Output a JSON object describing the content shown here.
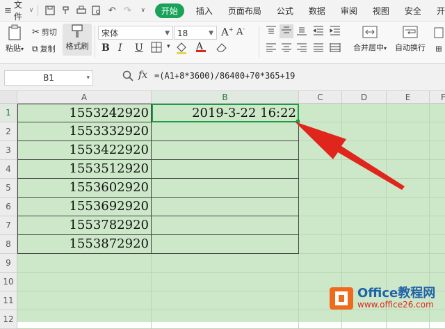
{
  "menu": {
    "file_label": "文件",
    "tabs": [
      "开始",
      "插入",
      "页面布局",
      "公式",
      "数据",
      "审阅",
      "视图",
      "安全",
      "开"
    ]
  },
  "ribbon": {
    "paste_label": "粘贴",
    "cut_label": "剪切",
    "copy_label": "复制",
    "format_brush_label": "格式刷",
    "font_name": "宋体",
    "font_size": "18",
    "bold": "B",
    "italic": "I",
    "underline": "U",
    "merge_center_label": "合并居中",
    "auto_wrap_label": "自动换行"
  },
  "formula_bar": {
    "name_box": "B1",
    "fx_label": "fx",
    "formula": "=(A1+8*3600)/86400+70*365+19"
  },
  "sheet": {
    "columns": [
      "A",
      "B",
      "C",
      "D",
      "E",
      "F"
    ],
    "rows": [
      "1",
      "2",
      "3",
      "4",
      "5",
      "6",
      "7",
      "8",
      "9",
      "10",
      "11",
      "12"
    ],
    "column_a_values": [
      "1553242920",
      "1553332920",
      "1553422920",
      "1553512920",
      "1553602920",
      "1553692920",
      "1553782920",
      "1553872920"
    ],
    "b1_value": "2019-3-22  16:22",
    "selected_cell": "B1"
  },
  "watermark": {
    "brand": "Office教程网",
    "url": "www.office26.com"
  },
  "colors": {
    "accent_green": "#19a35a",
    "grid_bg": "#cde8c9",
    "selection": "#1f9a47",
    "arrow_red": "#e0251c",
    "logo_orange": "#ef6a1a"
  }
}
